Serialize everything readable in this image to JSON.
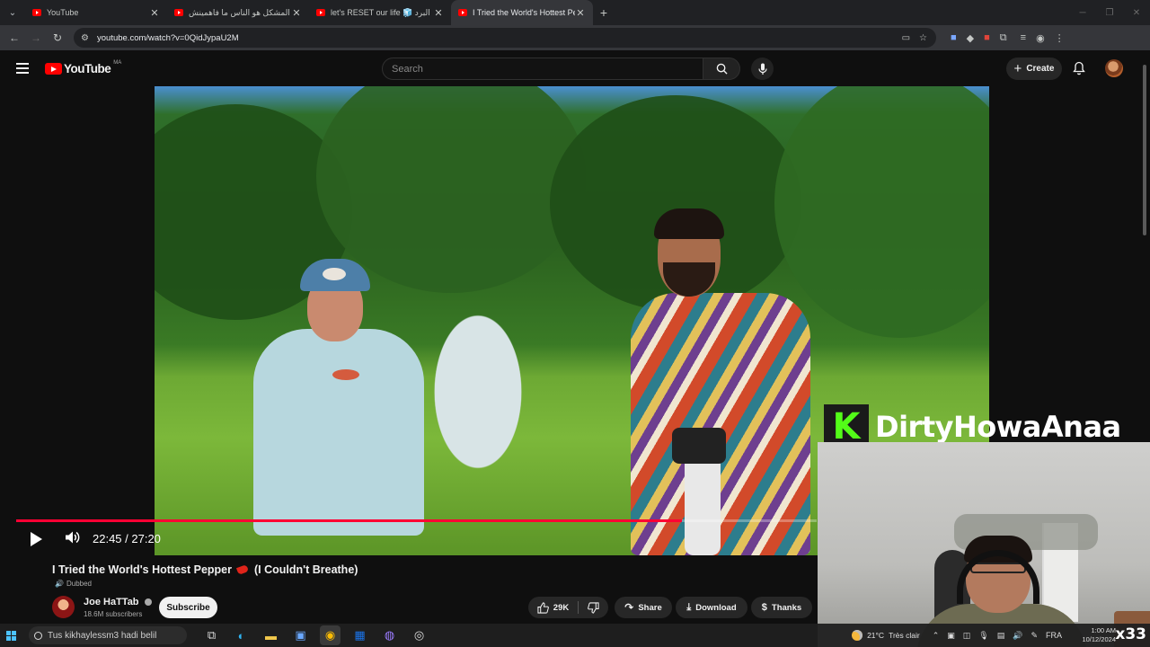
{
  "browser": {
    "tabs": [
      {
        "title": "YouTube",
        "active": false
      },
      {
        "title": "المشكل هو الناس ما فاهمينش",
        "active": false
      },
      {
        "title": "let's RESET our life 🧊 البرد",
        "active": false
      },
      {
        "title": "I Tried the World's Hottest Pepp",
        "active": true
      }
    ],
    "url": "youtube.com/watch?v=0QidJypaU2M"
  },
  "youtube": {
    "logo_text": "YouTube",
    "region": "MA",
    "search_placeholder": "Search",
    "create_label": "Create",
    "player": {
      "current_time": "22:45",
      "duration": "27:20",
      "time_display": "22:45 / 27:20",
      "progress_fraction": 0.832
    },
    "video": {
      "title_part1": "I Tried the World's Hottest Pepper",
      "title_part2": "(I Couldn't Breathe)",
      "dubbed_label": "Dubbed"
    },
    "channel": {
      "name": "Joe HaTTab",
      "subscribers": "18.6M subscribers",
      "subscribe_label": "Subscribe"
    },
    "actions": {
      "likes": "29K",
      "share": "Share",
      "download": "Download",
      "thanks": "Thanks"
    }
  },
  "overlay": {
    "kick_letter": "K",
    "streamer_name": "DirtyHowaAnaa",
    "corner_badge": "x33"
  },
  "taskbar": {
    "search_text": "Tus kikhaylessm3 hadi belil",
    "weather": "21°C",
    "weather_desc": "Très clair",
    "language": "FRA",
    "time": "1:00 AM",
    "date": "10/12/2024"
  },
  "colors": {
    "yt_red": "#ff0000",
    "progress_red": "#ff0033",
    "kick_green": "#53fc18"
  }
}
